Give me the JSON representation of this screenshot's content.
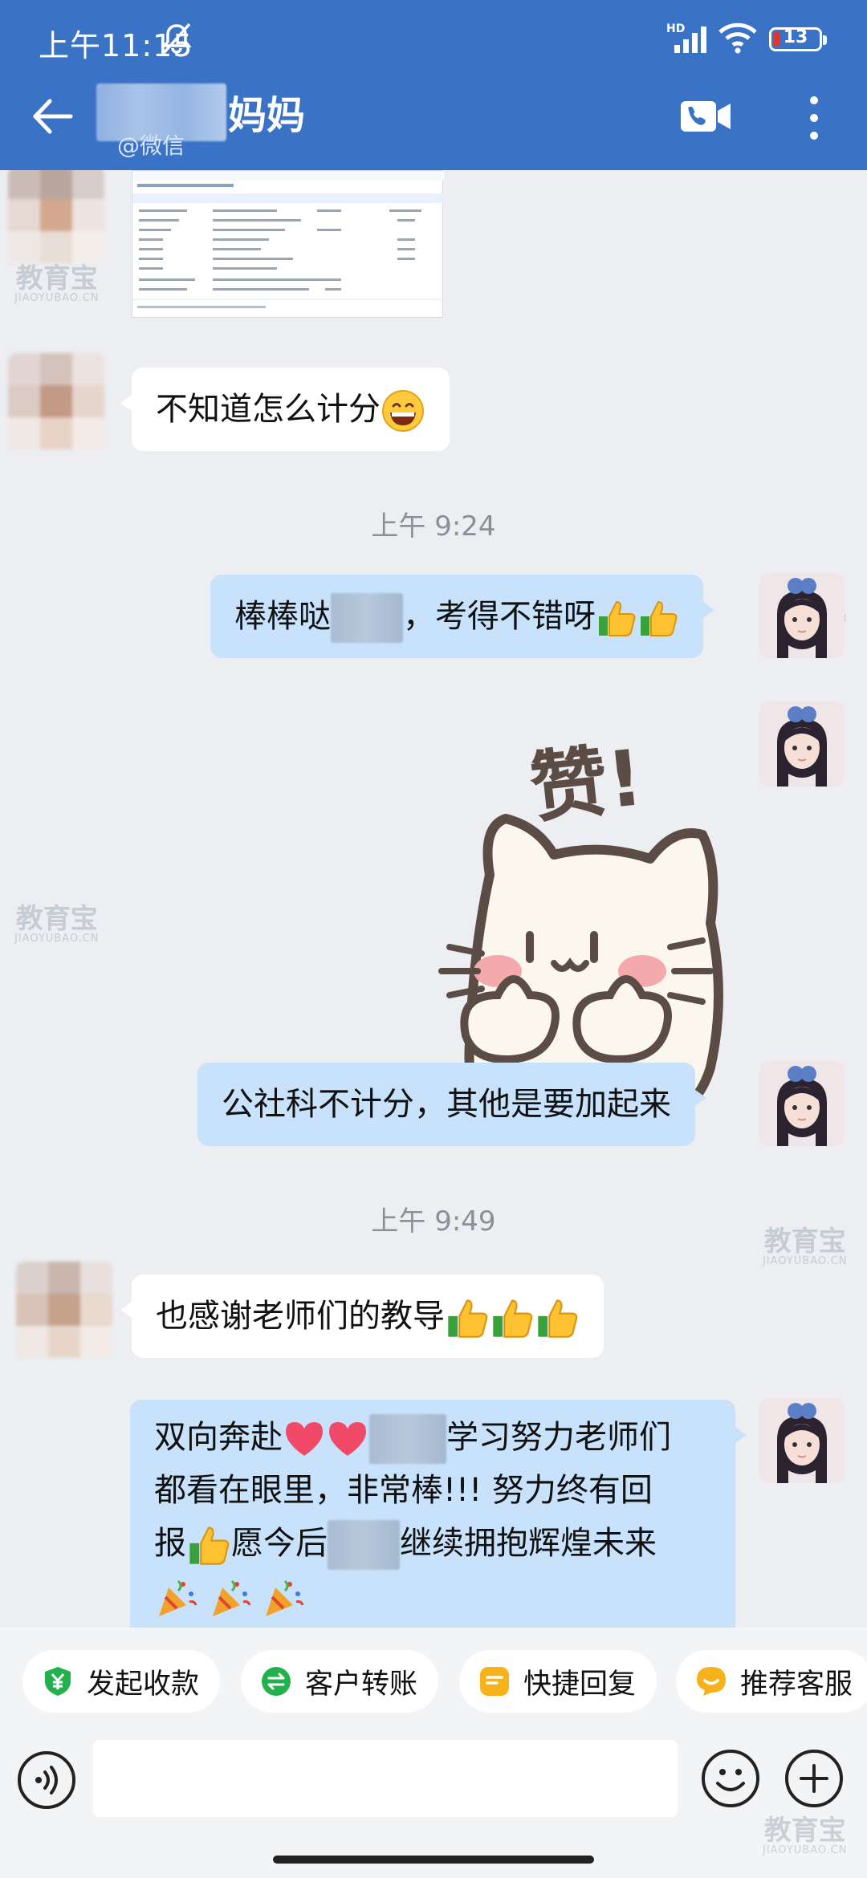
{
  "status_bar": {
    "time": "上午11:15",
    "network": "HD",
    "battery": "13"
  },
  "header": {
    "contact_name": "妈妈",
    "contact_source": "@微信"
  },
  "watermark": {
    "text": "教育宝",
    "sub": "JIAOYUBAO.CN"
  },
  "messages": [
    {
      "type": "file_image",
      "direction": "in"
    },
    {
      "type": "text",
      "direction": "in",
      "text": "不知道怎么计分"
    },
    {
      "type": "time",
      "text": "上午 9:24"
    },
    {
      "type": "text",
      "direction": "out",
      "before": "棒棒哒",
      "after": "，考得不错呀"
    },
    {
      "type": "sticker",
      "direction": "out",
      "sticker_text": "赞!"
    },
    {
      "type": "text",
      "direction": "out",
      "text": "公社科不计分，其他是要加起来"
    },
    {
      "type": "time",
      "text": "上午 9:49"
    },
    {
      "type": "text",
      "direction": "in",
      "text": "也感谢老师们的教导"
    },
    {
      "type": "text",
      "direction": "out",
      "line1_before": "双向奔赴",
      "line1_after": "学习努力老师们",
      "line2": "都看在眼里，非常棒!!! 努力终有回",
      "line3_a": "报",
      "line3_b": "愿今后",
      "line3_c": "继续拥抱辉煌未来"
    }
  ],
  "quick_actions": [
    {
      "label": "发起收款",
      "icon": "yuan-shield-icon",
      "color": "#22b14c"
    },
    {
      "label": "客户转账",
      "icon": "transfer-icon",
      "color": "#22b14c"
    },
    {
      "label": "快捷回复",
      "icon": "quick-reply-icon",
      "color": "#f5b21b"
    },
    {
      "label": "推荐客服",
      "icon": "recommend-icon",
      "color": "#f5b21b"
    }
  ],
  "input": {
    "placeholder": ""
  },
  "colors": {
    "header": "#3a72c6",
    "out_bubble": "#c8e2fb",
    "in_bubble": "#ffffff",
    "background": "#eceef2"
  }
}
